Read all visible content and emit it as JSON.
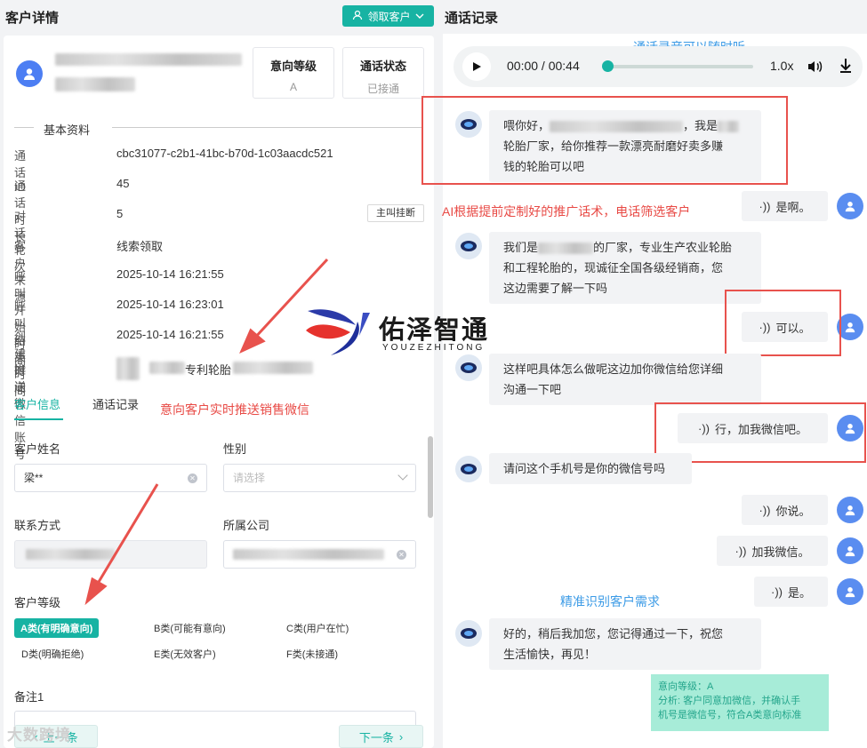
{
  "left": {
    "title": "客户详情",
    "claim_button": "领取客户",
    "stats": [
      {
        "label": "意向等级",
        "value": "A"
      },
      {
        "label": "通话状态",
        "value": "已接通"
      }
    ],
    "basic_section": "基本资料",
    "info": [
      {
        "label": "通话ID",
        "value": "cbc31077-c2b1-41bc-b70d-1c03aacdc521"
      },
      {
        "label": "通话时长",
        "value": "45"
      },
      {
        "label": "对话轮次",
        "value": "5"
      },
      {
        "label": "客户来源",
        "value": "线索领取"
      },
      {
        "label": "呼叫开始时间",
        "value": "2025-10-14 16:21:55"
      },
      {
        "label": "呼叫结束时间",
        "value": "2025-10-14 16:23:01"
      },
      {
        "label": "创建时间",
        "value": "2025-10-14 16:21:55"
      },
      {
        "label": "推送微信账号",
        "value": "专利轮胎"
      }
    ],
    "hangup_badge": "主叫挂断",
    "tabs": [
      "客户信息",
      "通话记录"
    ],
    "push_note": "意向客户实时推送销售微信",
    "form": {
      "name_label": "客户姓名",
      "name_value": "梁**",
      "gender_label": "性别",
      "gender_placeholder": "请选择",
      "contact_label": "联系方式",
      "company_label": "所属公司",
      "level_label": "客户等级",
      "levels": [
        "A类(有明确意向)",
        "B类(可能有意向)",
        "C类(用户在忙)",
        "D类(明确拒绝)",
        "E类(无效客户)",
        "F类(未接通)"
      ],
      "remark_label": "备注1"
    },
    "prev_button": "上一条",
    "next_button": "下一条",
    "watermark": "大数跨境"
  },
  "right": {
    "title": "通话记录",
    "player_note": "通话录音可以随时听",
    "player": {
      "time": "00:00 / 00:44",
      "speed": "1.0x",
      "progress": 0
    },
    "ai_note": "AI根据提前定制好的推广话术，电话筛选客户",
    "precise_note": "精准识别客户需求",
    "messages": [
      {
        "role": "bot",
        "line1_a": "喂你好，",
        "line1_b": "，我是",
        "line2": "轮胎厂家，给你推荐一款漂亮耐磨好卖多赚",
        "line3": "钱的轮胎可以吧"
      },
      {
        "role": "user",
        "text": "是啊。"
      },
      {
        "role": "bot",
        "line1_a": "我们是",
        "line1_b": "的厂家，专业生产农业轮胎",
        "line2": "和工程轮胎的，现诚征全国各级经销商，您",
        "line3": "这边需要了解一下吗"
      },
      {
        "role": "user",
        "text": "可以。"
      },
      {
        "role": "bot",
        "line1": "这样吧具体怎么做呢这边加你微信给您详细",
        "line2": "沟通一下吧"
      },
      {
        "role": "user",
        "text": "行，加我微信吧。"
      },
      {
        "role": "bot",
        "line1": "请问这个手机号是你的微信号吗"
      },
      {
        "role": "user",
        "text": "你说。"
      },
      {
        "role": "user",
        "text": "加我微信。"
      },
      {
        "role": "user",
        "text": "是。"
      },
      {
        "role": "bot",
        "line1": "好的，稍后我加您，您记得通过一下，祝您",
        "line2": "生活愉快，再见！"
      }
    ],
    "analysis": {
      "level": "意向等级：A",
      "line1": "分析: 客户同意加微信，并确认手",
      "line2": "机号是微信号，符合A类意向标准"
    }
  },
  "logo": {
    "name": "佑泽智通",
    "sub": "YOUZEZHITONG"
  },
  "colors": {
    "accent": "#17b3a3",
    "annotation_red": "#e8524d",
    "annotation_blue": "#3c9be6",
    "analysis_bg": "#a7ecd8"
  }
}
